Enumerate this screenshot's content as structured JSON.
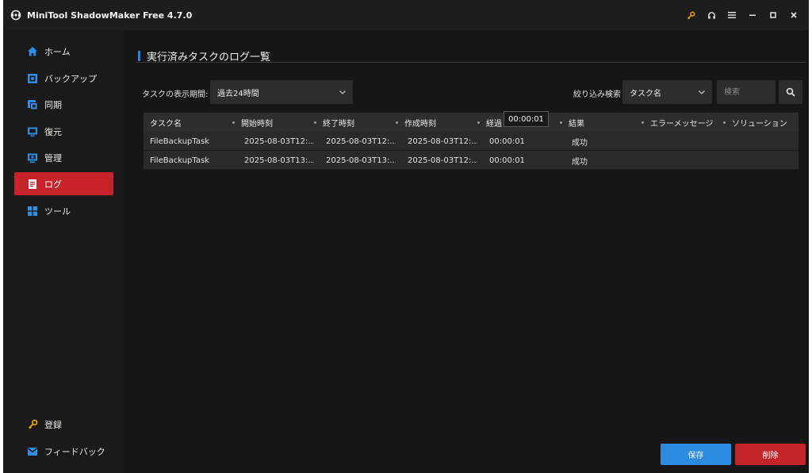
{
  "window": {
    "title": "MiniTool ShadowMaker Free 4.7.0",
    "controls": [
      "key-icon",
      "headset-icon",
      "menu-icon",
      "minimize-icon",
      "maximize-icon",
      "close-icon"
    ],
    "accent_key": "#f0a500"
  },
  "sidebar": {
    "items": [
      {
        "label": "ホーム",
        "icon": "home-icon"
      },
      {
        "label": "バックアップ",
        "icon": "backup-icon"
      },
      {
        "label": "同期",
        "icon": "sync-icon"
      },
      {
        "label": "復元",
        "icon": "restore-icon"
      },
      {
        "label": "管理",
        "icon": "manage-icon"
      },
      {
        "label": "ログ",
        "icon": "log-icon",
        "active": true
      },
      {
        "label": "ツール",
        "icon": "tools-icon"
      }
    ],
    "bottom": [
      {
        "label": "登録",
        "icon": "key-icon"
      },
      {
        "label": "フィードバック",
        "icon": "mail-icon"
      }
    ],
    "active_color": "#c8232a",
    "icon_color": "#2f8fe8"
  },
  "main": {
    "page_title": "実行済みタスクのログ一覧",
    "filter": {
      "period_label": "タスクの表示期間:",
      "period_value": "過去24時間",
      "narrow_label": "絞り込み検索",
      "field_value": "タスク名",
      "search_placeholder": "検索"
    },
    "table": {
      "columns": [
        "タスク名",
        "開始時刻",
        "終了時刻",
        "作成時刻",
        "経過",
        "結果",
        "エラーメッセージ",
        "ソリューション"
      ],
      "rows": [
        [
          "FileBackupTask",
          "2025-08-03T12:...",
          "2025-08-03T12:...",
          "2025-08-03T12:...",
          "00:00:01",
          "成功",
          "",
          ""
        ],
        [
          "FileBackupTask",
          "2025-08-03T13:...",
          "2025-08-03T13:...",
          "2025-08-03T12:...",
          "00:00:01",
          "成功",
          "",
          ""
        ]
      ]
    },
    "tooltip": "00:00:01",
    "buttons": {
      "save": "保存",
      "delete": "削除"
    }
  }
}
